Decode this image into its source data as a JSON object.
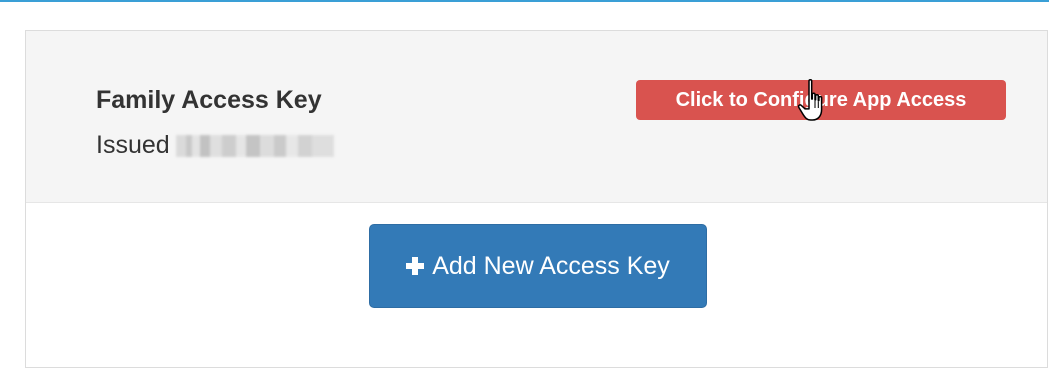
{
  "access_key": {
    "title": "Family Access Key",
    "issued_label": "Issued",
    "configure_button_label": "Click to Configure App Access"
  },
  "actions": {
    "add_key_label": "Add New Access Key",
    "add_key_icon": "plus-icon"
  },
  "colors": {
    "top_rule": "#3a9fd6",
    "configure_button": "#d9534f",
    "add_button": "#337ab7",
    "heading_background": "#f5f5f5"
  },
  "cursor": {
    "icon": "hand-pointer-icon"
  }
}
